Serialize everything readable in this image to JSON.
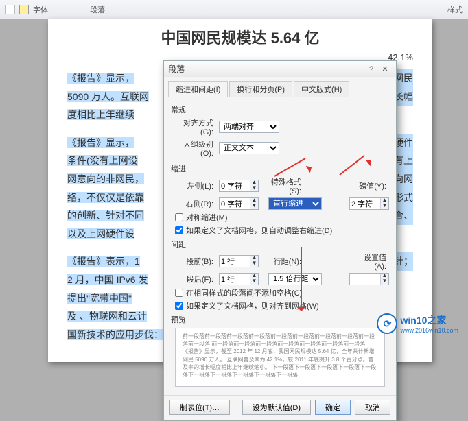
{
  "ribbon": {
    "group_font": "字体",
    "group_paragraph": "段落",
    "group_styles": "样式"
  },
  "document": {
    "title": "中国网民规模达 5.64 亿",
    "rate_text": "42.1%",
    "p1_a": "《报告》显示，",
    "p1_b": "……国网民",
    "p2_a": "5090 万人。互联网",
    "p2_b": "长幅",
    "p3": "度相比上年继续",
    "p4": "《报告》显示，",
    "p4b": "硬件",
    "p5": "条件(没有上网设",
    "p5b": "没有上",
    "p6": "网意向的非网民，",
    "p6b": "向网",
    "p7": "络，不仅仅是依靠",
    "p7b": "形式",
    "p8": "的创新、针对不同",
    "p8b": "结合、",
    "p9": "以及上网硬件设",
    "p10": "《报告》表示，1",
    "p10b": "方针；",
    "p11": "2 月，中国 IPv6 发",
    "p12": "提出\"宽带中国\"",
    "p13": "及 、物联网和云计",
    "p14": "国新技术的应用步伐：将推动互联网的持续创新。"
  },
  "dialog": {
    "title": "段落",
    "tabs": {
      "indent": "缩进和间距(I)",
      "paging": "换行和分页(P)",
      "chinese": "中文版式(H)"
    },
    "sections": {
      "general": "常规",
      "indent": "缩进",
      "spacing": "间距",
      "preview": "预览"
    },
    "labels": {
      "alignment": "对齐方式(G):",
      "outline": "大纲级别(O):",
      "left": "左侧(L):",
      "right": "右侧(R):",
      "special": "特殊格式(S):",
      "by_value": "磅值(Y):",
      "before": "段前(B):",
      "after": "段后(F):",
      "line_spacing": "行距(N):",
      "at": "设置值(A):"
    },
    "values": {
      "alignment": "两端对齐",
      "outline": "正文文本",
      "left": "0 字符",
      "right": "0 字符",
      "special": "首行缩进",
      "by_value": "2 字符",
      "before": "1 行",
      "after": "1 行",
      "line_spacing": "1.5 倍行距",
      "at": ""
    },
    "checks": {
      "mirror": "对称缩进(M)",
      "auto_indent": "如果定义了文档网格，则自动调整右缩进(D)",
      "no_space": "在相同样式的段落间不添加空格(C)",
      "snap_grid": "如果定义了文档网格，则对齐到网格(W)"
    },
    "preview_text": "前一段落前一段落前一段落前一段落前一段落前一段落前一段落前一段落前一段落前一段落\n前一段落前一段落前一段落前一段落前一段落前一段落前一段落\n《报告》显示，截至 2012 年 12 月底，我国网民规模达 5.64 亿，全年共计新增网民 5090 万人。\n互联网普及率为 42.1%，较 2011 年底提升 3.8 个百分点。普及率的增长幅度相比上年继续缩小。\n下一段落下一段落下一段落下一段落下一段落下一段落下一段落下一段落下一段落下一段落",
    "buttons": {
      "tabs": "制表位(T)…",
      "default": "设为默认值(D)",
      "ok": "确定",
      "cancel": "取消"
    }
  },
  "watermark": {
    "brand": "win10之家",
    "url": "www.2016win10.com"
  }
}
